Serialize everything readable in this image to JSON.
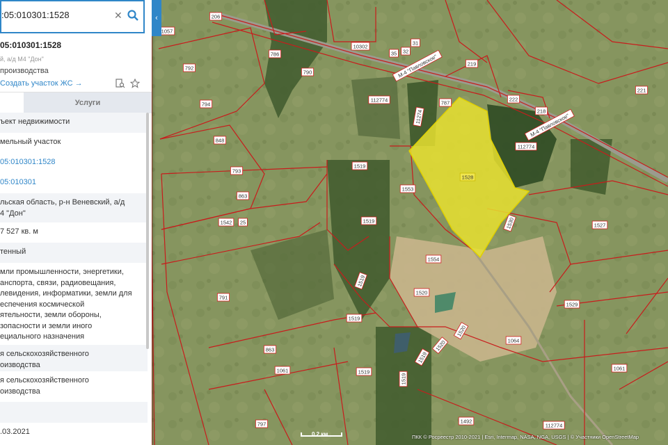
{
  "search": {
    "value": ":05:010301:1528"
  },
  "object": {
    "title": "05:010301:1528",
    "subtitle": "й, а/д М4 \"Дон\"",
    "type": "производства",
    "create_link": "Создать участок ЖС →"
  },
  "tabs": {
    "services": "Услуги"
  },
  "rows": [
    {
      "text": "ъект недвижимости",
      "style": "shade",
      "h": 29
    },
    {
      "text": "мельный участок",
      "style": "",
      "h": 29
    },
    {
      "text": "05:010301:1528",
      "style": "link",
      "h": 29
    },
    {
      "text": "05:010301",
      "style": "link",
      "h": 29
    },
    {
      "text": "льская область, р-н Веневский, а/д\n4 \"Дон\"",
      "style": "shade",
      "h": 42
    },
    {
      "text": "7 527 кв. м",
      "style": "",
      "h": 29
    },
    {
      "text": "тенный",
      "style": "shade",
      "h": 29
    },
    {
      "text": "мли промышленности, энергетики,\nанспорта, связи, радиовещания,\nлевидения, информатики, земли для\nеспечения космической\nятельности, земли обороны,\nзопасности и земли иного\nециального назначения",
      "style": "",
      "h": 118
    },
    {
      "text": "я сельскохозяйственного\nоизводства",
      "style": "shade",
      "h": 38
    },
    {
      "text": "я сельскохозяйственного\nоизводства",
      "style": "",
      "h": 44
    },
    {
      "text": "",
      "style": "shade",
      "h": 30
    },
    {
      "text": ".03.2021",
      "style": "",
      "h": 26
    }
  ],
  "map": {
    "parcel_labels": [
      "1057",
      "206",
      "786",
      "10302",
      "35",
      "32",
      "31",
      "219",
      "792",
      "790",
      "М-4 \"Павловское\"",
      "787",
      "794",
      "112774",
      "11274",
      "222",
      "218",
      "М-4 \"Павловское\"",
      "221",
      "848",
      "112774",
      "1528",
      "1519",
      "1553",
      "793",
      "863",
      "1519",
      "1542",
      "25",
      "1530",
      "1527",
      "1554",
      "1519",
      "1520",
      "1529",
      "791",
      "1519",
      "1520",
      "1064",
      "863",
      "1520",
      "1061",
      "1519",
      "1519",
      "1061",
      "797",
      "1492",
      "112774",
      "1519"
    ],
    "highlight_color": "#e8e030",
    "scale_label": "0.2 км",
    "attribution": "ПКК © Росреестр 2010-2021 | Esri, Intermap, NASA, NGA, USGS | © Участники OpenStreetMap"
  }
}
